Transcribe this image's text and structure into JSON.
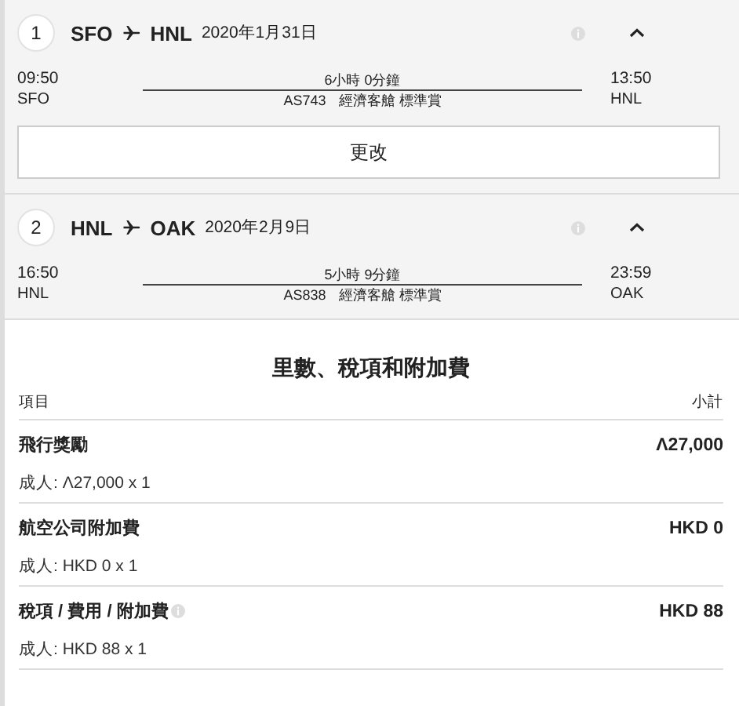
{
  "legs": [
    {
      "number": "1",
      "from": "SFO",
      "to": "HNL",
      "date": "2020年1月31日",
      "expanded": true,
      "depart_time": "09:50",
      "depart_airport": "SFO",
      "duration": "6小時 0分鐘",
      "flight": "AS743",
      "cabin": "經濟客艙 標準賞",
      "arrive_time": "13:50",
      "arrive_airport": "HNL",
      "button": "更改"
    },
    {
      "number": "2",
      "from": "HNL",
      "to": "OAK",
      "date": "2020年2月9日",
      "expanded": true,
      "depart_time": "16:50",
      "depart_airport": "HNL",
      "duration": "5小時 9分鐘",
      "flight": "AS838",
      "cabin": "經濟客艙 標準賞",
      "arrive_time": "23:59",
      "arrive_airport": "OAK"
    }
  ],
  "fees": {
    "title": "里數、稅項和附加費",
    "columns": [
      "項目",
      "小計"
    ],
    "rows": [
      {
        "label": "飛行獎勵",
        "info": false,
        "amount": "Λ27,000",
        "detail": "成人: Λ27,000 x 1"
      },
      {
        "label": "航空公司附加費",
        "info": false,
        "amount": "HKD 0",
        "detail": "成人: HKD 0 x 1"
      },
      {
        "label": "稅項 / 費用 / 附加費",
        "info": true,
        "amount": "HKD 88",
        "detail": "成人: HKD 88 x 1"
      }
    ]
  }
}
